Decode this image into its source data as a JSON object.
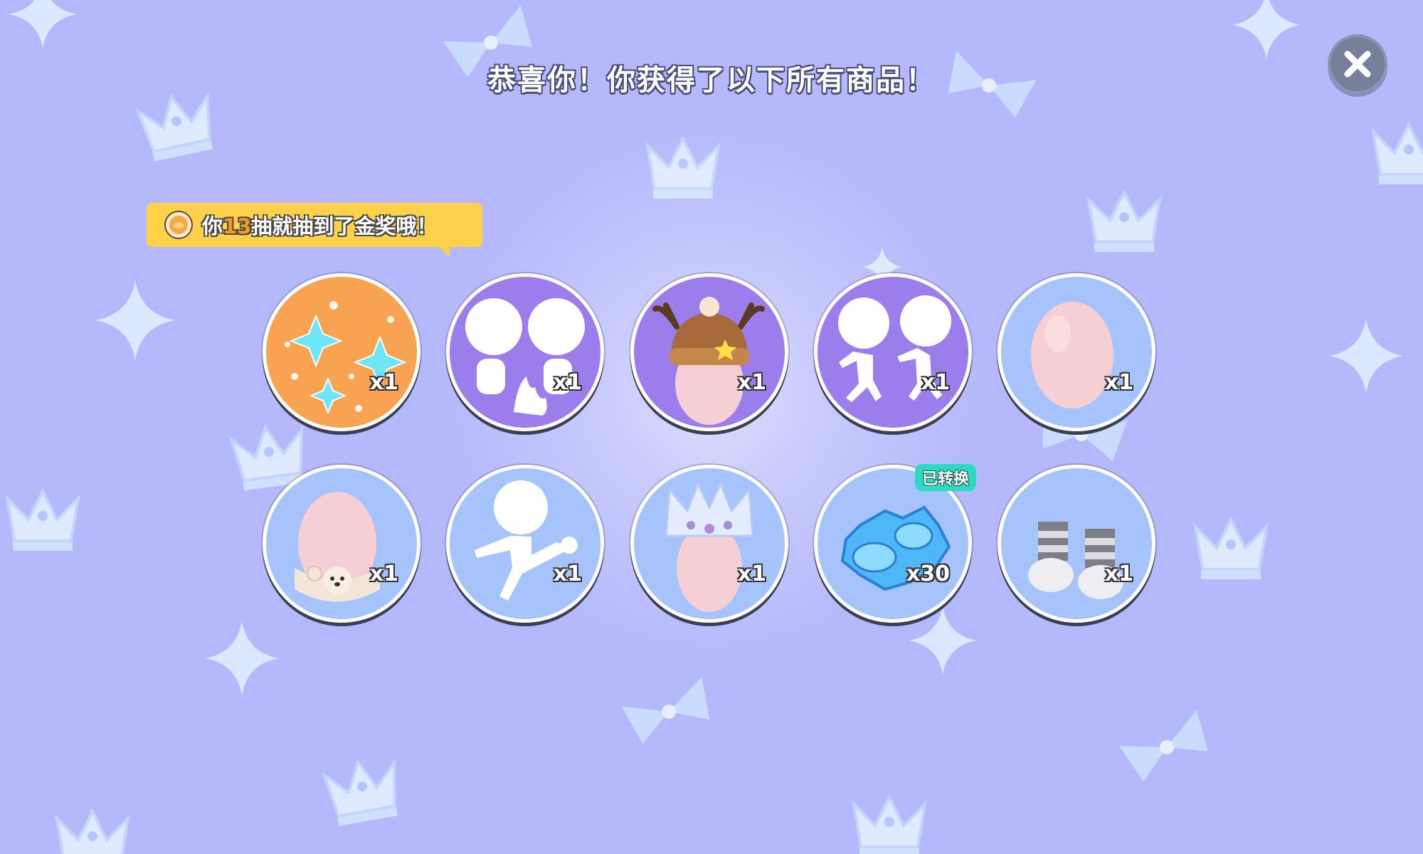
{
  "header": {
    "title": "恭喜你！你获得了以下所有商品！",
    "close_icon": "close-icon"
  },
  "banner": {
    "prefix": "你",
    "draw_count": "13",
    "suffix": "抽就抽到了金奖哦！",
    "icon": "coin-icon"
  },
  "colors": {
    "background": "#b5b9fb",
    "orange_tile": "#f7a352",
    "purple_tile": "#9c7dec",
    "blue_tile": "#a7c3fb",
    "banner": "#fdd24a",
    "converted_badge": "#2fd9c2"
  },
  "items": [
    {
      "name": "snowflake-effect",
      "icon": "snowflake-icon",
      "qty": "x1",
      "tier": "orange"
    },
    {
      "name": "campfire-emote",
      "icon": "campfire-emote-icon",
      "qty": "x1",
      "tier": "purple"
    },
    {
      "name": "reindeer-beanie",
      "icon": "reindeer-hat-icon",
      "qty": "x1",
      "tier": "purple"
    },
    {
      "name": "skating-emote",
      "icon": "skating-emote-icon",
      "qty": "x1",
      "tier": "purple"
    },
    {
      "name": "pink-head",
      "icon": "pink-head-icon",
      "qty": "x1",
      "tier": "blue"
    },
    {
      "name": "bear-scarf",
      "icon": "bear-scarf-icon",
      "qty": "x1",
      "tier": "blue"
    },
    {
      "name": "kick-pose",
      "icon": "kick-pose-icon",
      "qty": "x1",
      "tier": "blue"
    },
    {
      "name": "ice-crown",
      "icon": "ice-crown-icon",
      "qty": "x1",
      "tier": "blue"
    },
    {
      "name": "ice-gear-currency",
      "icon": "ice-gear-icon",
      "qty": "x30",
      "tier": "blue",
      "badge": "已转换"
    },
    {
      "name": "striped-boots",
      "icon": "striped-boots-icon",
      "qty": "x1",
      "tier": "blue"
    }
  ]
}
